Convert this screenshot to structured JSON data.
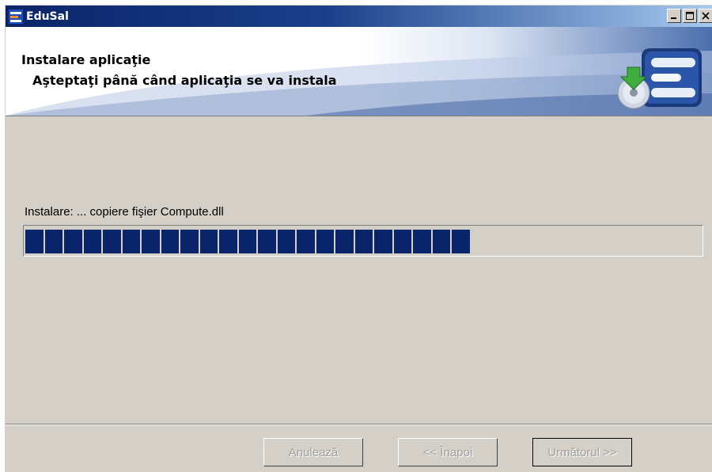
{
  "window": {
    "title": "EduSal",
    "app_icon": "edusal-app-icon"
  },
  "title_buttons": [
    {
      "name": "minimize-button",
      "icon": "minimize-icon"
    },
    {
      "name": "maximize-button",
      "icon": "maximize-icon"
    },
    {
      "name": "close-button",
      "icon": "close-icon"
    }
  ],
  "header": {
    "title": "Instalare aplicaţie",
    "subtitle": "Aşteptaţi până când aplicaţia se va instala",
    "logo_icon": "install-disc-logo-icon"
  },
  "status": {
    "text": "Instalare:  ... copiere fişier Compute.dll"
  },
  "progress": {
    "value": 0.69,
    "total_segments": 34,
    "filled_segments": 23,
    "color": "#0a246a"
  },
  "buttons": {
    "cancel_label": "Anulează",
    "back_label": "<< Înapoi",
    "next_label": "Următorul >>"
  },
  "colors": {
    "titlebar": "#0a246a",
    "face": "#d4d0c8",
    "disabled_text": "#a0a0a0"
  }
}
